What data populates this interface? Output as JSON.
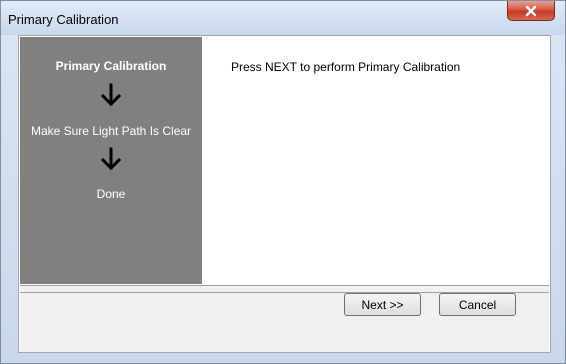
{
  "window": {
    "title": "Primary Calibration",
    "close_icon": "close-icon"
  },
  "steps": {
    "items": [
      {
        "label": "Primary Calibration",
        "current": true
      },
      {
        "label": "Make Sure Light Path Is Clear",
        "current": false
      },
      {
        "label": "Done",
        "current": false
      }
    ],
    "arrow_icon": "arrow-down-icon",
    "panel_color": "#808080"
  },
  "main": {
    "message": "Press NEXT to perform Primary Calibration"
  },
  "buttons": {
    "next_label": "Next >>",
    "cancel_label": "Cancel"
  }
}
